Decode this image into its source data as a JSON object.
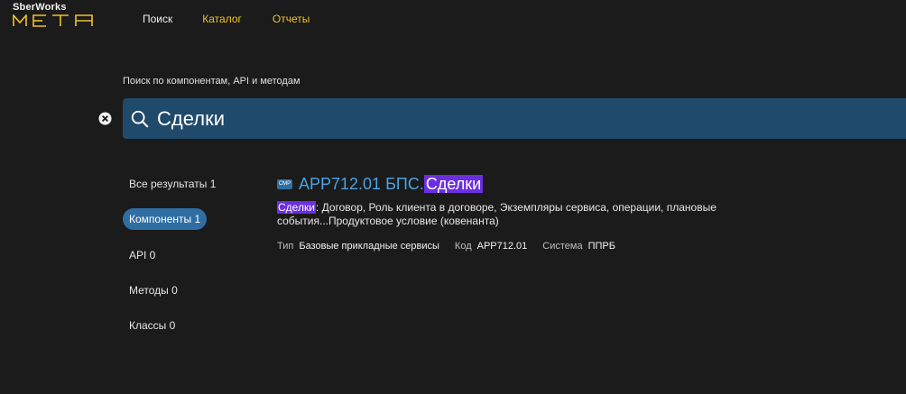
{
  "logo": {
    "top": "SberWorks",
    "bottom": "META"
  },
  "nav": {
    "search": "Поиск",
    "catalog": "Каталог",
    "reports": "Отчеты"
  },
  "search": {
    "caption": "Поиск по компонентам, API и методам",
    "value": "Сделки"
  },
  "filters": [
    {
      "label": "Все результаты 1",
      "active": false
    },
    {
      "label": "Компоненты 1",
      "active": true
    },
    {
      "label": "API 0",
      "active": false
    },
    {
      "label": "Методы 0",
      "active": false
    },
    {
      "label": "Классы 0",
      "active": false
    }
  ],
  "result": {
    "badge": "CMP",
    "title_prefix": "APP712.01 БПС.",
    "title_highlight": "Сделки",
    "desc_highlight": "Сделки",
    "desc_rest": ": Договор, Роль клиента в договоре, Экземпляры сервиса, операции, плановые события...Продуктовое условие (ковенанта)",
    "meta": {
      "type_label": "Тип",
      "type_value": "Базовые прикладные сервисы",
      "code_label": "Код",
      "code_value": "APP712.01",
      "system_label": "Система",
      "system_value": "ППРБ"
    }
  },
  "colors": {
    "background": "#1b1b1b",
    "nav_accent": "#f0c030",
    "search_box": "#1f4a6b",
    "link": "#4aa3e6",
    "highlight": "#6b2fe0",
    "active_filter": "#2f6ea3"
  }
}
